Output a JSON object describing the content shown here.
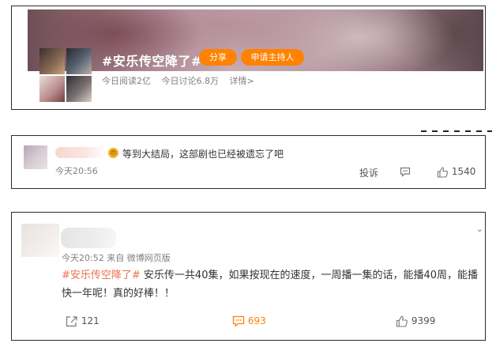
{
  "topic": {
    "title": "#安乐传空降了#",
    "share_label": "分享",
    "host_label": "申请主持人",
    "reads": "今日阅读2亿",
    "discuss": "今日讨论6.8万",
    "details": "详情>"
  },
  "comment": {
    "emoji_name": "angry-face",
    "text": "等到大结局，这部剧也已经被遗忘了吧",
    "time": "今天20:56",
    "report_label": "投诉",
    "like_count": "1540"
  },
  "post": {
    "time": "今天20:52",
    "source": "来自 微博网页版",
    "hashtag": "#安乐传空降了#",
    "body": " 安乐传一共40集，如果按现在的速度，一周播一集的话，能播40周，能播快一年呢！真的好棒！！",
    "forward_count": "121",
    "comment_count": "693",
    "like_count": "9399"
  },
  "colors": {
    "accent": "#ff8200",
    "hashtag": "#eb7350"
  }
}
